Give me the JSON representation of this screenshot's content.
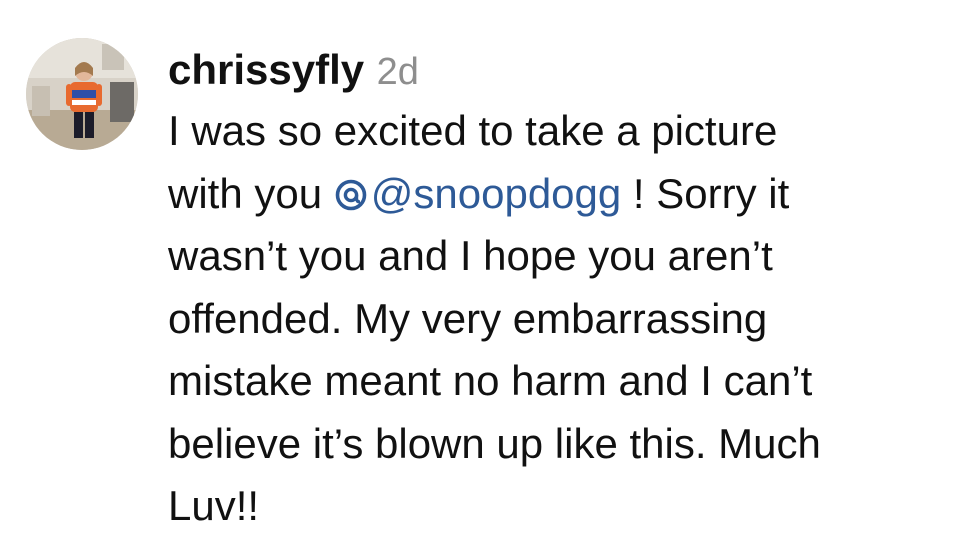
{
  "comment": {
    "username": "chrissyfly",
    "timestamp": "2d",
    "lines": [
      [
        "I was so excited to take a picture"
      ],
      [
        "with you ",
        "@snoopdogg",
        " ! Sorry it"
      ],
      [
        "wasn’t you and I hope you aren’t"
      ],
      [
        "offended. My very embarrassing"
      ],
      [
        "mistake meant no harm and I can’t"
      ],
      [
        "believe it’s blown up like this. Much"
      ],
      [
        "Luv!!"
      ]
    ],
    "mention": {
      "icon": "threads-icon",
      "handle": "@snoopdogg",
      "color": "#2e5a97"
    },
    "avatar_icon": "avatar-photo"
  }
}
